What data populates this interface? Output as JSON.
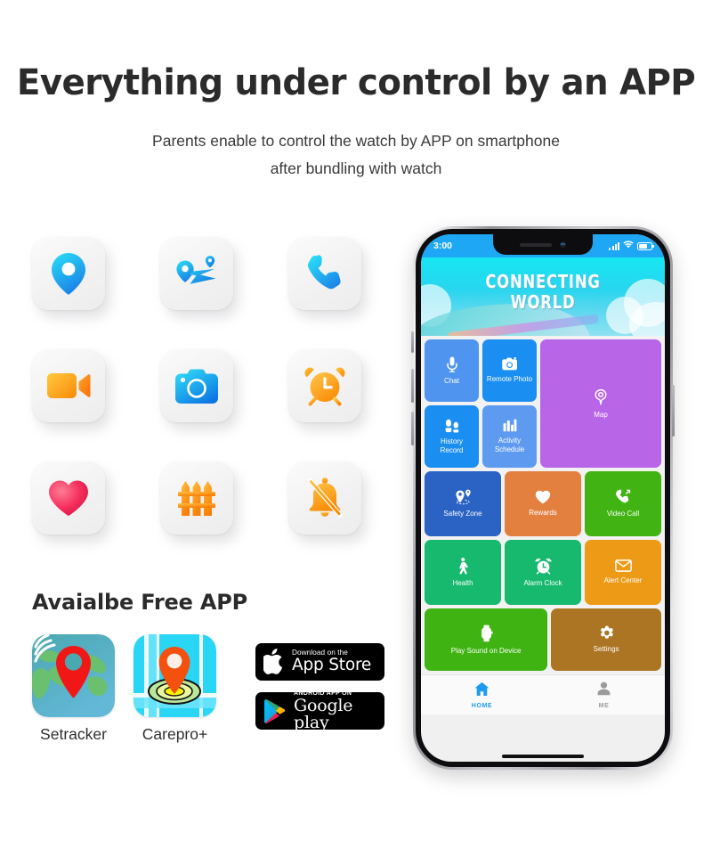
{
  "header": {
    "title": "Everything under control by an APP",
    "subtitle_line1": "Parents enable to control the watch by APP on smartphone",
    "subtitle_line2": "after bundling with watch"
  },
  "features": {
    "items": [
      {
        "icon": "location-pin-icon",
        "name": "location"
      },
      {
        "icon": "route-map-icon",
        "name": "route-tracking"
      },
      {
        "icon": "phone-call-icon",
        "name": "phone-call"
      },
      {
        "icon": "video-camera-icon",
        "name": "video-call"
      },
      {
        "icon": "camera-icon",
        "name": "remote-camera"
      },
      {
        "icon": "alarm-clock-icon",
        "name": "alarm-clock"
      },
      {
        "icon": "heart-icon",
        "name": "health-heart"
      },
      {
        "icon": "fence-icon",
        "name": "safety-fence"
      },
      {
        "icon": "bell-off-icon",
        "name": "do-not-disturb"
      }
    ]
  },
  "available_app": {
    "title": "Avaialbe Free APP",
    "apps": [
      {
        "name": "Setracker",
        "icon": "setracker-app-icon"
      },
      {
        "name": "Carepro+",
        "icon": "carepro-app-icon"
      }
    ],
    "badges": [
      {
        "id": "app-store",
        "top": "Download on the",
        "bottom": "App Store",
        "icon": "apple-logo-icon"
      },
      {
        "id": "google-play",
        "top": "ANDROID APP ON",
        "bottom": "Google play",
        "icon": "google-play-icon"
      }
    ]
  },
  "phone": {
    "status_bar": {
      "time": "3:00",
      "signal_icon": "signal-bars-icon",
      "wifi_icon": "wifi-icon",
      "battery_icon": "battery-icon"
    },
    "hero": {
      "line1": "CONNECTING",
      "line2": "WORLD"
    },
    "tiles": [
      {
        "label": "Chat",
        "icon": "microphone-icon",
        "color": "#4f95f0"
      },
      {
        "label": "Remote Photo",
        "icon": "camera-icon",
        "color": "#1b8ef2"
      },
      {
        "label": "History\nRecord",
        "icon": "footprints-icon",
        "color": "#1b8ef2"
      },
      {
        "label": "Activity\nSchedule",
        "icon": "bar-chart-icon",
        "color": "#5e9bf0"
      },
      {
        "label": "Map",
        "icon": "map-pin-icon",
        "color": "#b865e8"
      },
      {
        "label": "Safety Zone",
        "icon": "geofence-pin-icon",
        "color": "#2a63c4"
      },
      {
        "label": "Rewards",
        "icon": "heart-icon",
        "color": "#e4803f"
      },
      {
        "label": "Video Call",
        "icon": "phone-call-icon",
        "color": "#41b313"
      },
      {
        "label": "Health",
        "icon": "walking-person-icon",
        "color": "#16b96e"
      },
      {
        "label": "Alarm Clock",
        "icon": "alarm-clock-icon",
        "color": "#16b96e"
      },
      {
        "label": "Alert Center",
        "icon": "envelope-icon",
        "color": "#ed9b17"
      },
      {
        "label": "Play Sound on Device",
        "icon": "smartwatch-icon",
        "color": "#3eb312"
      },
      {
        "label": "Settings",
        "icon": "gear-icon",
        "color": "#ac7524"
      }
    ],
    "tabbar": [
      {
        "label": "HOME",
        "icon": "home-icon",
        "active": true,
        "color": "#1e9bf0"
      },
      {
        "label": "ME",
        "icon": "person-icon",
        "active": false,
        "color": "#9a9a9a"
      }
    ]
  },
  "colors": {
    "accent_blue": "#1ea7f5",
    "title_dark": "#2b2b2b",
    "phone_bg": "#f2f2f2"
  }
}
